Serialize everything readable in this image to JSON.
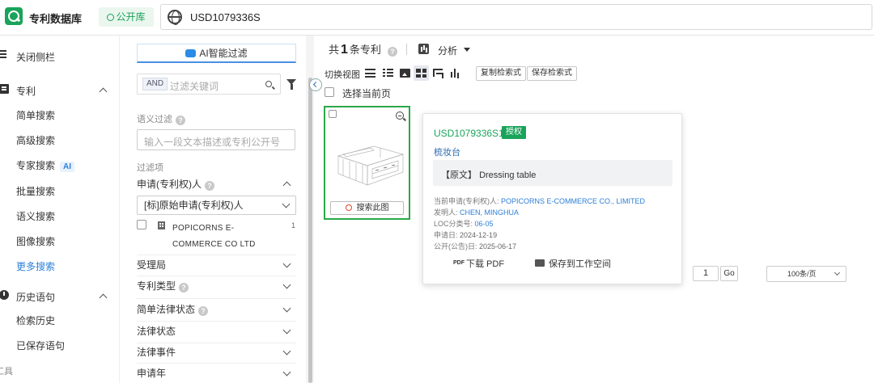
{
  "header": {
    "app_title": "专利数据库",
    "db_chip": "公开库",
    "query": "USD1079336S"
  },
  "sidebar": {
    "collapse_label": "关闭侧栏",
    "patent_section": "专利",
    "items": [
      "简单搜索",
      "高级搜索",
      "专家搜索",
      "批量搜索",
      "语义搜索",
      "图像搜索",
      "更多搜索"
    ],
    "ai_tag": "AI",
    "history_section": "历史语句",
    "history_items": [
      "检索历史",
      "已保存语句"
    ],
    "tools_section": "工具"
  },
  "filter": {
    "ai_filter_label": "AI智能过滤",
    "and_chip": "AND",
    "keyword_placeholder": "过滤关键词",
    "semantic_label": "语义过滤",
    "semantic_placeholder": "输入一段文本描述或专利公开号",
    "filter_items_label": "过滤项",
    "applicant_head": "申请(专利权)人",
    "applicant_select": "[标]原始申请(专利权)人",
    "applicant_option": "POPICORNS E-COMMERCE CO LTD",
    "applicant_count": "1",
    "sections": [
      "受理局",
      "专利类型",
      "简单法律状态",
      "法律状态",
      "法律事件",
      "申请年"
    ]
  },
  "main": {
    "count_prefix": "共",
    "count": "1",
    "count_suffix": "条专利",
    "analysis": "分析",
    "view_switch": "切换视图",
    "copy_query": "复制检索式",
    "save_query": "保存检索式",
    "select_page": "选择当前页",
    "search_this": "搜索此图",
    "page_value": "1",
    "go": "Go",
    "per_page": "100条/页"
  },
  "popup": {
    "pub_number": "USD1079336S1",
    "status": "授权",
    "title_cn": "梳妆台",
    "original_prefix": "【原文】",
    "original_title": "Dressing table",
    "fields": [
      {
        "label": "当前申请(专利权)人:",
        "value": "POPICORNS E-COMMERCE CO., LIMITED",
        "link": true
      },
      {
        "label": "发明人:",
        "value": "CHEN, MINGHUA",
        "link": true
      },
      {
        "label": "LOC分类号:",
        "value": "06-05",
        "link": true
      },
      {
        "label": "申请日:",
        "value": "2024-12-19",
        "link": false
      },
      {
        "label": "公开(公告)日:",
        "value": "2025-06-17",
        "link": false
      }
    ],
    "pdf_tag": "PDF",
    "download_pdf": "下载 PDF",
    "save_workspace": "保存到工作空间"
  },
  "colors": {
    "brand_green": "#1aa35a",
    "link_blue": "#2b7fd8",
    "card_border": "#2aa84a"
  }
}
